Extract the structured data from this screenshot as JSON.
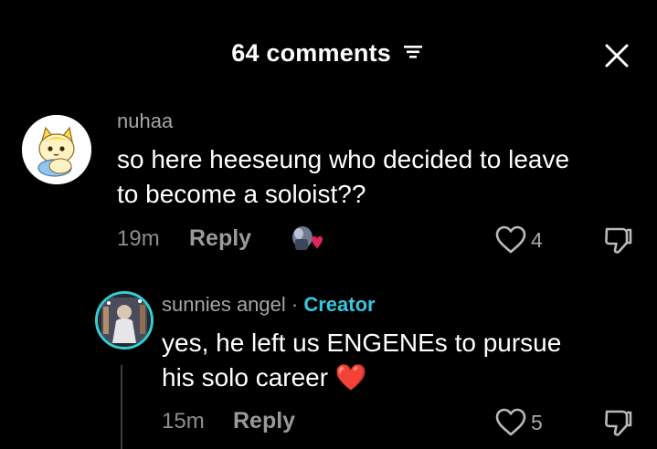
{
  "header": {
    "title": "64 comments",
    "filter_icon": "filter-icon",
    "close_icon": "close-icon"
  },
  "comments": [
    {
      "username": "nuhaa",
      "text_lines": [
        "so here heeseung who decided to leave",
        "to become a soloist??"
      ],
      "time": "19m",
      "reply_label": "Reply",
      "likes": "4",
      "avatar_icon": "cartoon-cat-avatar",
      "sticker_icon": "sticker-image"
    },
    {
      "username": "sunnies angel",
      "separator": " · ",
      "badge": "Creator",
      "text_lines": [
        "yes, he left us ENGENEs to pursue",
        "his solo career ❤️"
      ],
      "time": "15m",
      "reply_label": "Reply",
      "likes": "5",
      "avatar_icon": "photo-avatar"
    }
  ],
  "colors": {
    "background": "#000000",
    "creator": "#34c7e0",
    "avatar_ring": "#2fd0d8",
    "heart": "#e0245e"
  }
}
